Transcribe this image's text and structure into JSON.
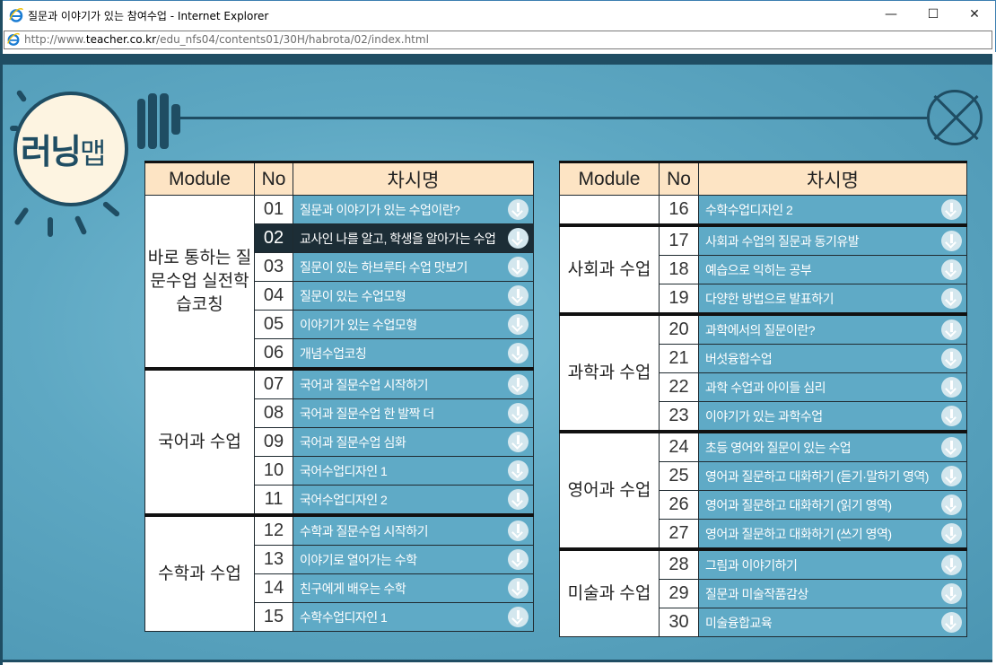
{
  "window": {
    "title": "질문과 이야기가 있는 참여수업 - Internet Explorer",
    "minimize": "—",
    "maximize": "☐",
    "close": "✕"
  },
  "address": {
    "url_prefix": "http://www.",
    "url_domain": "teacher.co.kr",
    "url_rest": "/edu_nfs04/contents01/30H/habrota/02/index.html"
  },
  "logo": {
    "main": "러닝",
    "suffix": "맵"
  },
  "headers": {
    "module": "Module",
    "no": "No",
    "title": "차시명"
  },
  "left_table": {
    "groups": [
      {
        "module": "바로 통하는 질문수업 실전학습코칭",
        "rows": [
          {
            "no": "01",
            "title": "질문과 이야기가 있는 수업이란?"
          },
          {
            "no": "02",
            "title": "교사인 나를 알고, 학생을 알아가는 수업",
            "selected": true
          },
          {
            "no": "03",
            "title": "질문이 있는 하브루타 수업 맛보기"
          },
          {
            "no": "04",
            "title": "질문이 있는 수업모형"
          },
          {
            "no": "05",
            "title": "이야기가 있는 수업모형"
          },
          {
            "no": "06",
            "title": "개념수업코칭"
          }
        ]
      },
      {
        "module": "국어과 수업",
        "rows": [
          {
            "no": "07",
            "title": "국어과 질문수업 시작하기"
          },
          {
            "no": "08",
            "title": "국어과 질문수업 한 발짝 더"
          },
          {
            "no": "09",
            "title": "국어과 질문수업 심화"
          },
          {
            "no": "10",
            "title": "국어수업디자인 1"
          },
          {
            "no": "11",
            "title": "국어수업디자인 2"
          }
        ]
      },
      {
        "module": "수학과 수업",
        "rows": [
          {
            "no": "12",
            "title": "수학과 질문수업 시작하기"
          },
          {
            "no": "13",
            "title": "이야기로 열어가는 수학"
          },
          {
            "no": "14",
            "title": "친구에게 배우는 수학"
          },
          {
            "no": "15",
            "title": "수학수업디자인 1"
          }
        ]
      }
    ]
  },
  "right_table": {
    "groups": [
      {
        "module": "",
        "rows": [
          {
            "no": "16",
            "title": "수학수업디자인 2"
          }
        ]
      },
      {
        "module": "사회과 수업",
        "rows": [
          {
            "no": "17",
            "title": "사회과 수업의 질문과 동기유발"
          },
          {
            "no": "18",
            "title": "예습으로 익히는 공부"
          },
          {
            "no": "19",
            "title": "다양한 방법으로 발표하기"
          }
        ]
      },
      {
        "module": "과학과 수업",
        "rows": [
          {
            "no": "20",
            "title": "과학에서의 질문이란?"
          },
          {
            "no": "21",
            "title": "버섯융합수업"
          },
          {
            "no": "22",
            "title": "과학 수업과 아이들 심리"
          },
          {
            "no": "23",
            "title": "이야기가 있는 과학수업"
          }
        ]
      },
      {
        "module": "영어과 수업",
        "rows": [
          {
            "no": "24",
            "title": "초등 영어와 질문이 있는 수업"
          },
          {
            "no": "25",
            "title": "영어과 질문하고 대화하기 (듣기·말하기 영역)"
          },
          {
            "no": "26",
            "title": "영어과 질문하고 대화하기 (읽기 영역)"
          },
          {
            "no": "27",
            "title": "영어과 질문하고 대화하기 (쓰기 영역)"
          }
        ]
      },
      {
        "module": "미술과 수업",
        "rows": [
          {
            "no": "28",
            "title": "그림과 이야기하기"
          },
          {
            "no": "29",
            "title": "질문과 미술작품감상"
          },
          {
            "no": "30",
            "title": "미술융합교육"
          }
        ]
      }
    ]
  },
  "colors": {
    "header_bg": "#fde4c4",
    "title_cell_bg": "#5faac6",
    "selected_bg": "#1c2d36",
    "frame": "#1f4d63"
  }
}
